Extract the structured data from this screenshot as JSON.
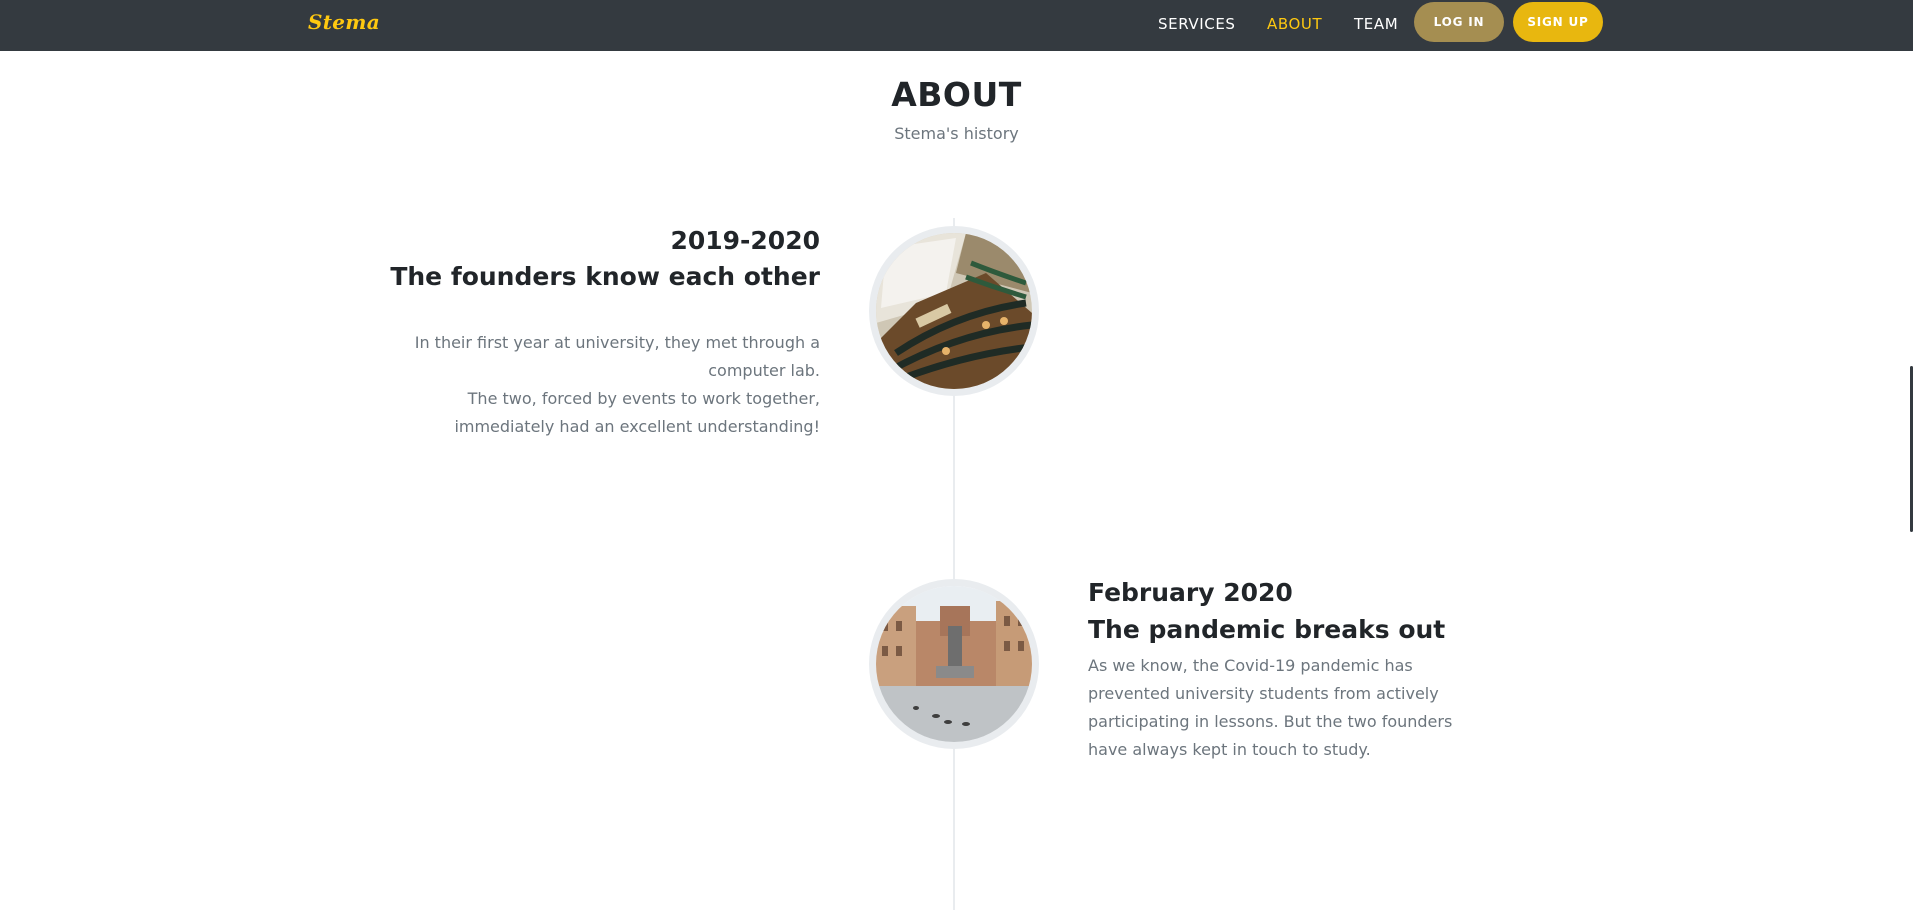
{
  "nav": {
    "brand": "Stema",
    "links": [
      "SERVICES",
      "ABOUT",
      "TEAM"
    ],
    "login": "LOG IN",
    "signup": "SIGN UP",
    "active": "ABOUT"
  },
  "section": {
    "heading": "ABOUT",
    "subheading": "Stema's history"
  },
  "timeline": [
    {
      "date": "2019-2020",
      "title": "The founders know each other",
      "body_lines": [
        "In their first year at university, they met through a",
        "computer lab.",
        "The two, forced by events to work together,",
        "immediately had an excellent understanding!"
      ],
      "image": "lecture-hall-photo"
    },
    {
      "date": "February 2020",
      "title": "The pandemic breaks out",
      "body_lines": [
        "As we know, the Covid-19 pandemic has",
        "prevented university students from actively",
        "participating in lessons. But the two founders",
        "have always kept in touch to study."
      ],
      "image": "empty-city-square-photo"
    }
  ],
  "colors": {
    "navbar": "#343a40",
    "accent": "#fec810",
    "login_button": "#a58e51",
    "signup_button": "#e8b70f",
    "muted_text": "#6c757d",
    "heading_text": "#212529",
    "timeline_line": "#e9ecef"
  }
}
